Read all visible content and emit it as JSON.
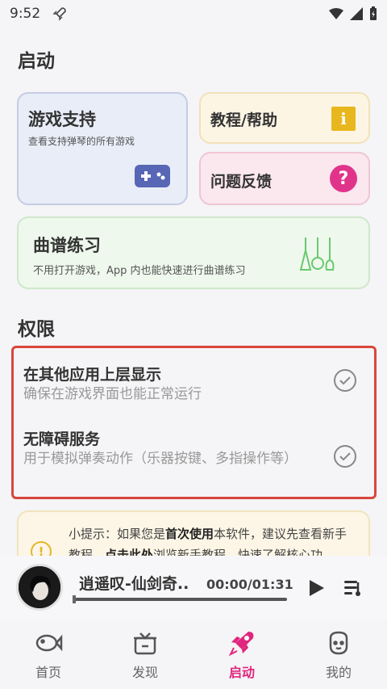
{
  "status_bar": {
    "time": "9:52"
  },
  "section_launch": "启动",
  "cards": {
    "games": {
      "title": "游戏支持",
      "subtitle": "查看支持弹琴的所有游戏"
    },
    "help": {
      "title": "教程/帮助",
      "icon_glyph": "i"
    },
    "feedback": {
      "title": "问题反馈",
      "icon_glyph": "?"
    },
    "practice": {
      "title": "曲谱练习",
      "subtitle": "不用打开游戏，App 内也能快速进行曲谱练习"
    }
  },
  "section_permissions": "权限",
  "permissions": [
    {
      "title": "在其他应用上层显示",
      "desc": "确保在游戏界面也能正常运行"
    },
    {
      "title": "无障碍服务",
      "desc": "用于模拟弹奏动作（乐器按键、多指操作等）"
    }
  ],
  "tip": {
    "icon_glyph": "!",
    "prefix": "小提示：如果您是",
    "bold1": "首次使用",
    "middle": "本软件，建议先查看新手教程，",
    "bold2": "点击此处",
    "suffix": "浏览新手教程，快速了解核心功"
  },
  "player": {
    "song_title": "逍遥叹-仙剑奇..",
    "time": "00:00/01:31"
  },
  "tabs": [
    {
      "label": "首页",
      "icon": "fish-icon",
      "active": false
    },
    {
      "label": "发现",
      "icon": "box-icon",
      "active": false
    },
    {
      "label": "启动",
      "icon": "rocket-icon",
      "active": true
    },
    {
      "label": "我的",
      "icon": "face-icon",
      "active": false
    }
  ],
  "colors": {
    "accent": "#e0267e",
    "highlight_border": "#d9463b"
  }
}
